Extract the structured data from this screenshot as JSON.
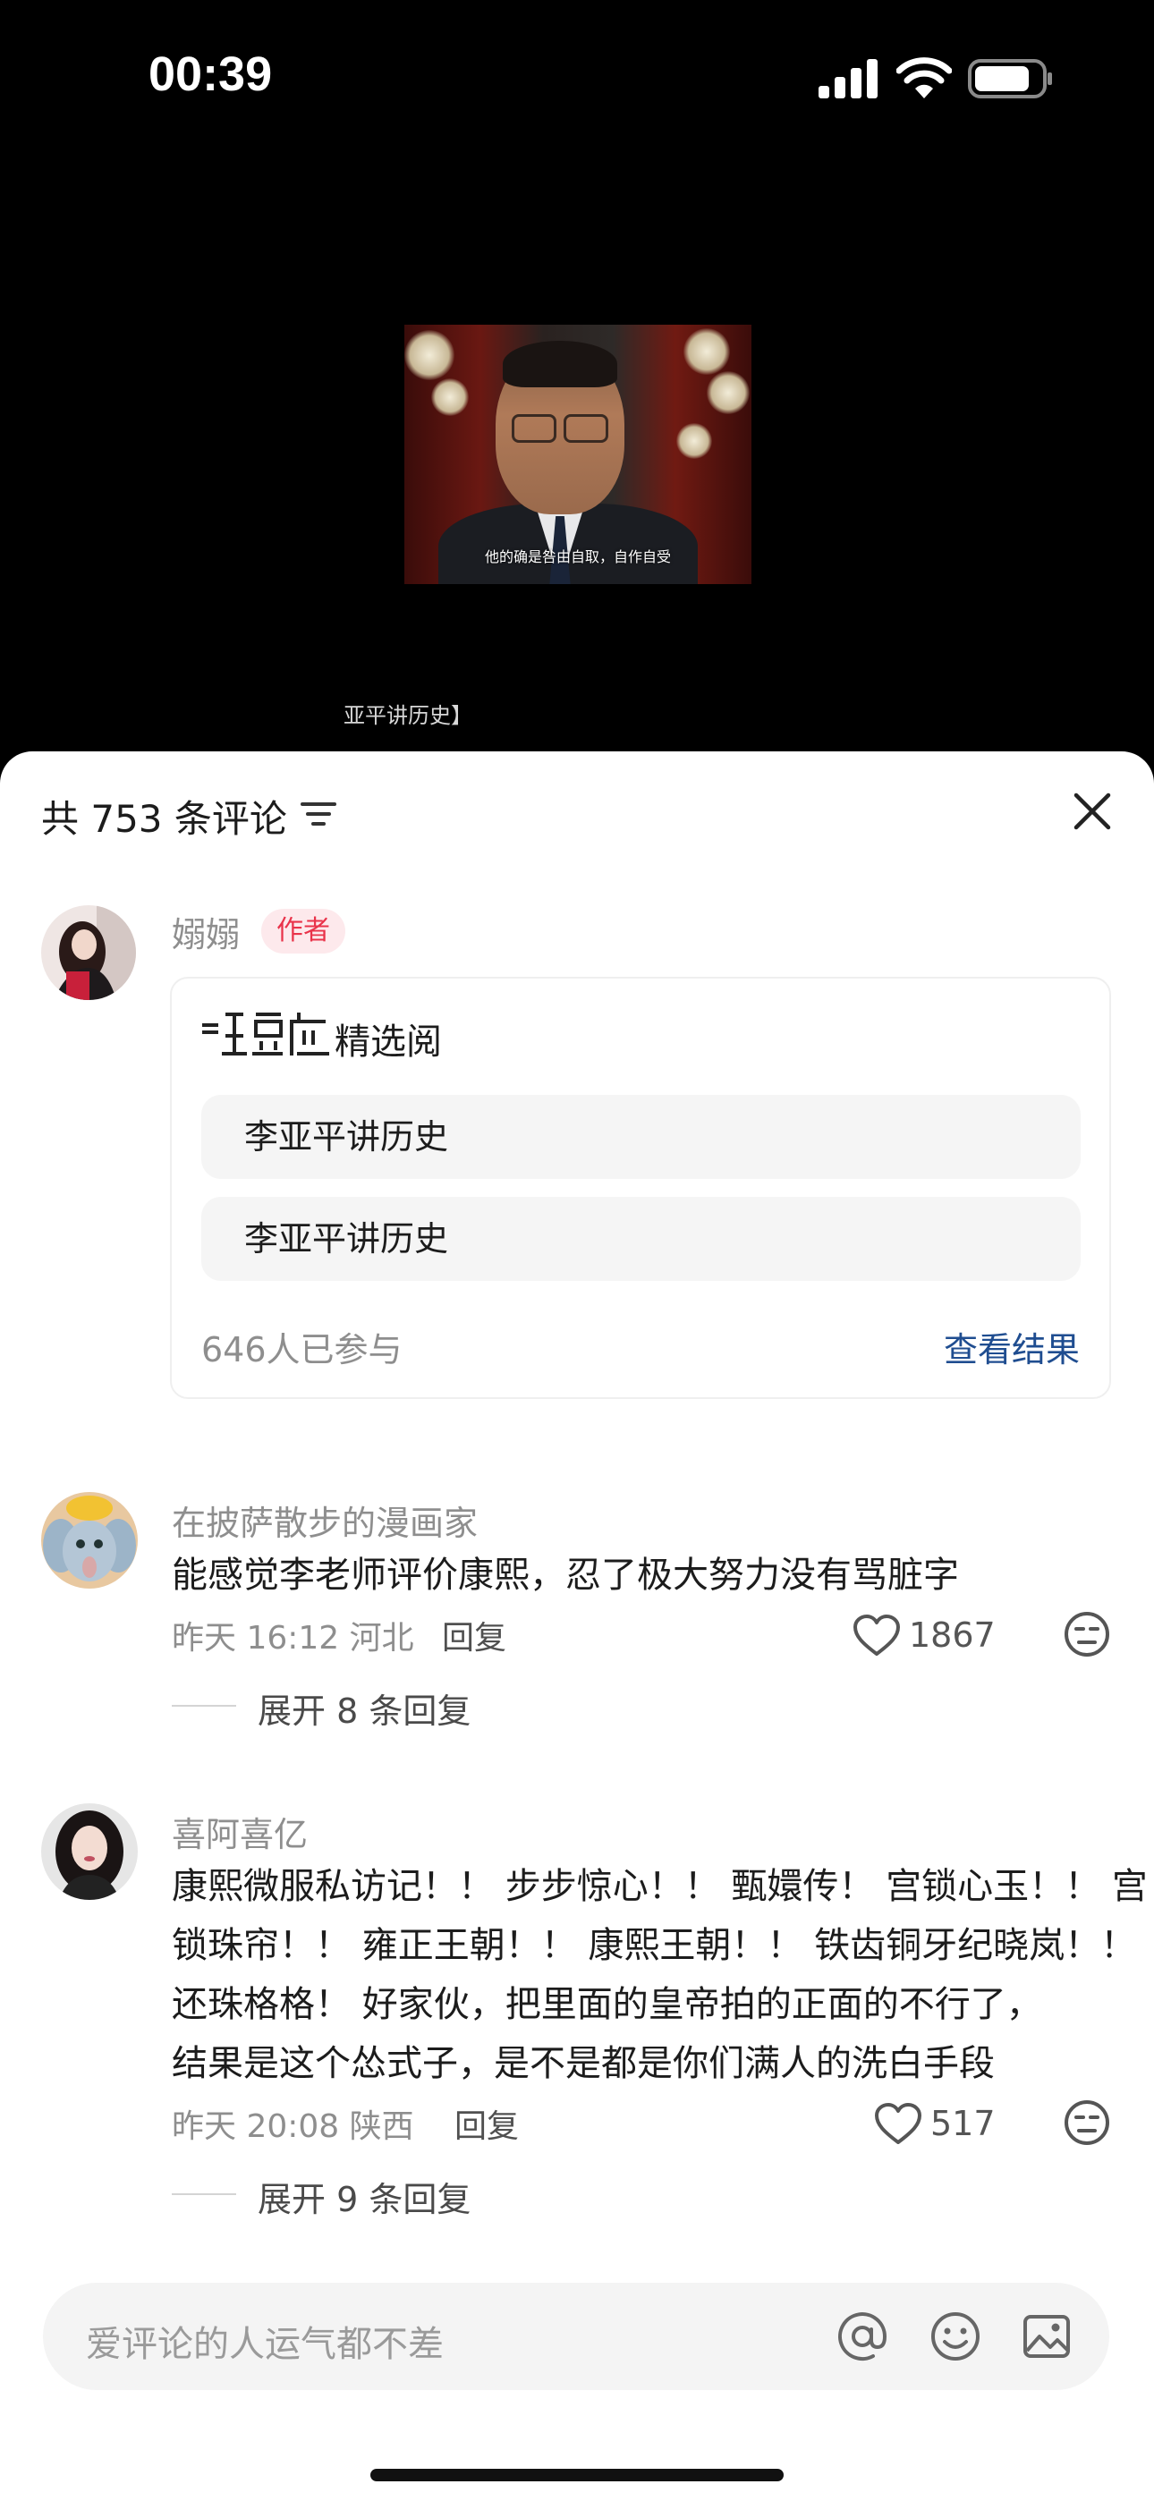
{
  "status_bar": {
    "time": "00:39"
  },
  "video": {
    "subtitle": "他的确是咎由自取，自作自受",
    "caption": "亚平讲历史】"
  },
  "comments_sheet": {
    "count_label": "共 753 条评论",
    "filter_icon": "filter-lines-icon",
    "close_icon": "close-x-icon"
  },
  "author_post": {
    "nickname": "嫋嫋",
    "badge": "作者",
    "poll": {
      "title": "精选阅",
      "options": [
        "李亚平讲历史",
        "李亚平讲历史"
      ],
      "participants": "646人已参与",
      "view_results": "查看结果"
    }
  },
  "comments": [
    {
      "nickname": "在披萨散步的漫画家",
      "text": [
        "能感觉李老师评价康熙，忍了极大努力没有骂脏字"
      ],
      "time_location": "昨天 16:12 河北",
      "reply_label": "回复",
      "likes": "1867",
      "expand": "展开 8 条回复"
    },
    {
      "nickname": "喜阿喜亿",
      "text": [
        "康熙微服私访记！！ 步步惊心！！ 甄嬛传！ 宫锁心玉！！ 宫",
        "锁珠帘！！ 雍正王朝！！ 康熙王朝！！ 铁齿铜牙纪晓岚！！",
        "还珠格格！ 好家伙，把里面的皇帝拍的正面的不行了，",
        "结果是这个怂式子，是不是都是你们满人的洗白手段"
      ],
      "time_location": "昨天 20:08 陕西",
      "reply_label": "回复",
      "likes": "517",
      "expand": "展开 9 条回复"
    }
  ],
  "input_bar": {
    "placeholder": "爱评论的人运气都不差",
    "icons": [
      "at-icon",
      "emoji-icon",
      "image-icon"
    ]
  },
  "colors": {
    "author_badge_text": "#e9334a",
    "link": "#1f4d90"
  }
}
